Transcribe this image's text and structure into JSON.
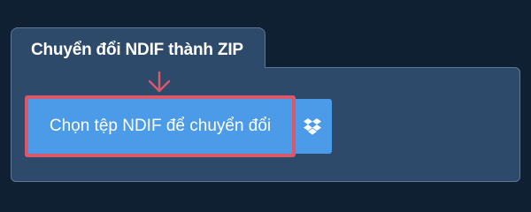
{
  "converter": {
    "tab_title": "Chuyển đổi NDIF thành ZIP",
    "choose_file_label": "Chọn tệp NDIF để chuyển đổi",
    "dropbox_icon": "dropbox-icon",
    "pointer_icon": "arrow-down-icon"
  },
  "colors": {
    "page_background": "#0f2033",
    "panel_background": "#2d4a6b",
    "button_background": "#4c9be8",
    "highlight_border": "#d9596a"
  }
}
